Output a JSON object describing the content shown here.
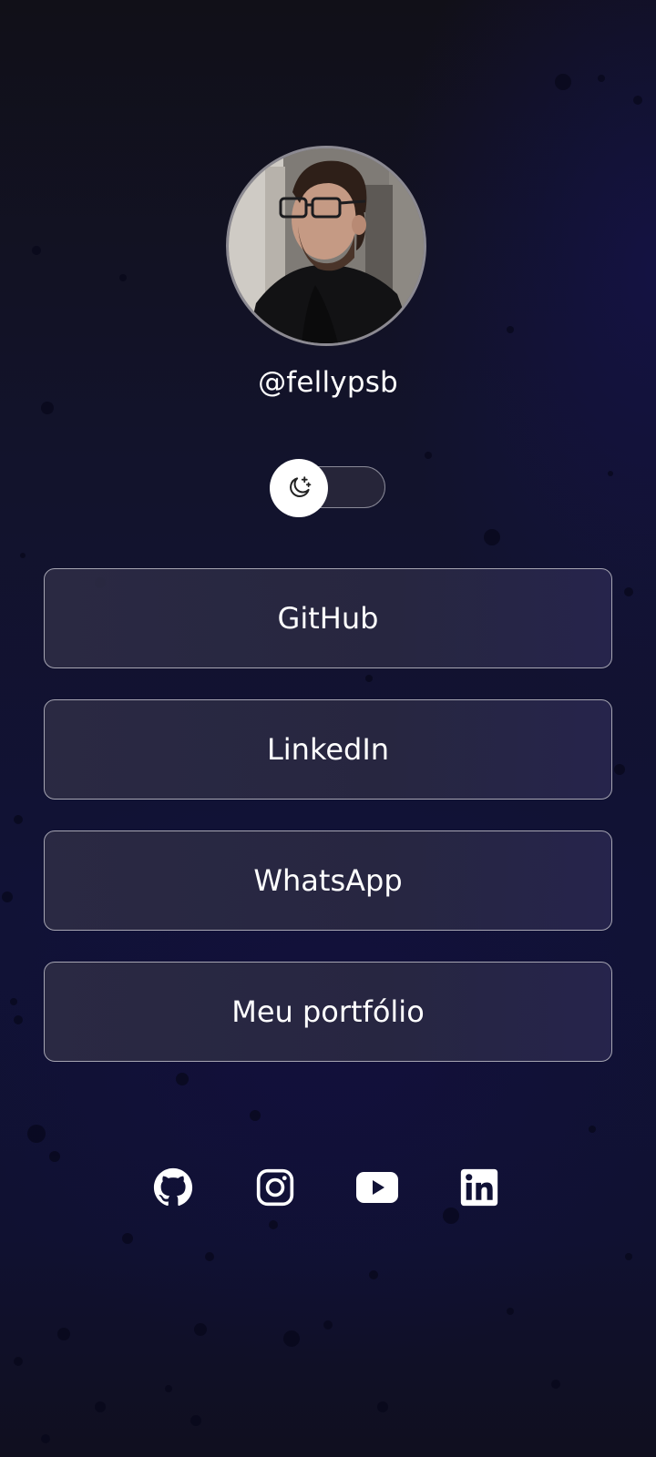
{
  "profile": {
    "username": "@fellypsb"
  },
  "theme_toggle": {
    "icon": "moon-stars-icon",
    "state": "dark"
  },
  "links": [
    {
      "label": "GitHub"
    },
    {
      "label": "LinkedIn"
    },
    {
      "label": "WhatsApp"
    },
    {
      "label": "Meu portfólio"
    }
  ],
  "socials": [
    {
      "icon": "github-icon"
    },
    {
      "icon": "instagram-icon"
    },
    {
      "icon": "youtube-icon"
    },
    {
      "icon": "linkedin-icon"
    }
  ],
  "colors": {
    "background": "#111236",
    "button_border": "#a6a5b2",
    "button_fill": "#2b2a44",
    "text": "#ffffff"
  }
}
